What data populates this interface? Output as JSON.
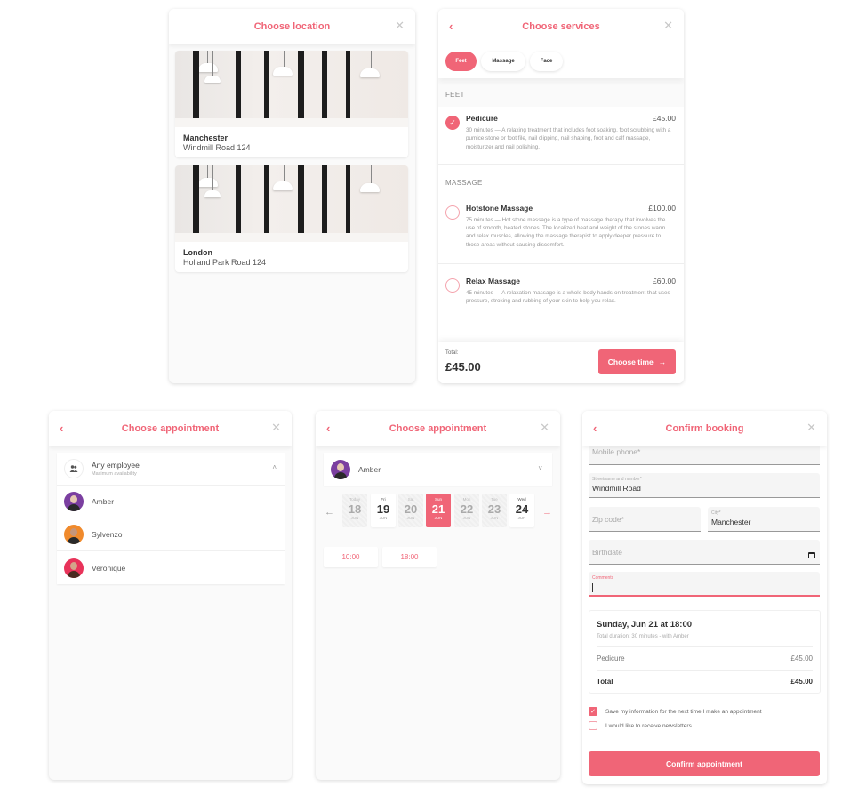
{
  "colors": {
    "accent": "#f06577",
    "accent_light": "#f4a3ad",
    "text": "#333333",
    "muted": "#999999"
  },
  "location_panel": {
    "title": "Choose location",
    "close_icon": "close-icon",
    "locations": [
      {
        "name": "Manchester",
        "address": "Windmill Road 124"
      },
      {
        "name": "London",
        "address": "Holland Park Road 124"
      }
    ]
  },
  "services_panel": {
    "title": "Choose services",
    "back_icon": "chevron-left-icon",
    "close_icon": "close-icon",
    "tabs": [
      {
        "label": "Feet",
        "active": true
      },
      {
        "label": "Massage",
        "active": false
      },
      {
        "label": "Face",
        "active": false
      }
    ],
    "categories": [
      {
        "label": "FEET",
        "services": [
          {
            "name": "Pedicure",
            "price": "£45.00",
            "selected": true,
            "description": "30 minutes — A relaxing treatment that includes foot soaking, foot scrubbing with a pumice stone or foot file, nail clipping, nail shaping, foot and calf massage, moisturizer and nail polishing."
          }
        ]
      },
      {
        "label": "MASSAGE",
        "services": [
          {
            "name": "Hotstone Massage",
            "price": "£100.00",
            "selected": false,
            "description": "75 minutes — Hot stone massage is a type of massage therapy that involves the use of smooth, heated stones. The localized heat and weight of the stones warm and relax muscles, allowing the massage therapist to apply deeper pressure to those areas without causing discomfort."
          },
          {
            "name": "Relax Massage",
            "price": "£60.00",
            "selected": false,
            "description": "45 minutes — A relaxation massage is a whole-body hands-on treatment that uses pressure, stroking and rubbing of your skin to help you relax."
          }
        ]
      }
    ],
    "footer": {
      "total_label": "Total:",
      "total_value": "£45.00",
      "button_label": "Choose time",
      "button_icon": "→"
    }
  },
  "employee_panel": {
    "title": "Choose appointment",
    "any": {
      "name": "Any employee",
      "subtitle": "Maximum availability",
      "icon": "users-icon",
      "chevron": "˄"
    },
    "employees": [
      {
        "name": "Amber",
        "avatar_color": "#7b3fa0"
      },
      {
        "name": "Sylvenzo",
        "avatar_color": "#f08a2c"
      },
      {
        "name": "Veronique",
        "avatar_color": "#e8335a"
      }
    ]
  },
  "date_panel": {
    "title": "Choose appointment",
    "selected_employee": "Amber",
    "chevron": "˅",
    "prev_icon": "←",
    "next_icon": "→",
    "dates": [
      {
        "dow": "Today",
        "day": "18",
        "month": "JUN",
        "state": "disabled"
      },
      {
        "dow": "Fri",
        "day": "19",
        "month": "JUN",
        "state": "available"
      },
      {
        "dow": "Sat",
        "day": "20",
        "month": "JUN",
        "state": "disabled"
      },
      {
        "dow": "Sun",
        "day": "21",
        "month": "JUN",
        "state": "selected"
      },
      {
        "dow": "Mon",
        "day": "22",
        "month": "JUN",
        "state": "disabled"
      },
      {
        "dow": "Tue",
        "day": "23",
        "month": "JUN",
        "state": "disabled"
      },
      {
        "dow": "Wed",
        "day": "24",
        "month": "JUN",
        "state": "available"
      }
    ],
    "slots": [
      "10:00",
      "18:00"
    ]
  },
  "confirm_panel": {
    "title": "Confirm booking",
    "fields": {
      "mobile": {
        "placeholder": "Mobile phone*",
        "value": ""
      },
      "street": {
        "label": "Streetname and number*",
        "value": "Windmill Road"
      },
      "zip": {
        "placeholder": "Zip code*",
        "value": ""
      },
      "city": {
        "label": "City*",
        "value": "Manchester"
      },
      "birthdate": {
        "placeholder": "Birthdate",
        "value": ""
      },
      "comments": {
        "label": "Comments",
        "value": ""
      }
    },
    "summary": {
      "title": "Sunday, Jun 21 at 18:00",
      "subtitle": "Total duration: 30 minutes - with Amber",
      "line_name": "Pedicure",
      "line_price": "£45.00",
      "total_label": "Total",
      "total_value": "£45.00"
    },
    "checkboxes": [
      {
        "label": "Save my information for the next time I make an appointment",
        "checked": true
      },
      {
        "label": "I would like to receive newsletters",
        "checked": false
      }
    ],
    "button_label": "Confirm appointment"
  }
}
